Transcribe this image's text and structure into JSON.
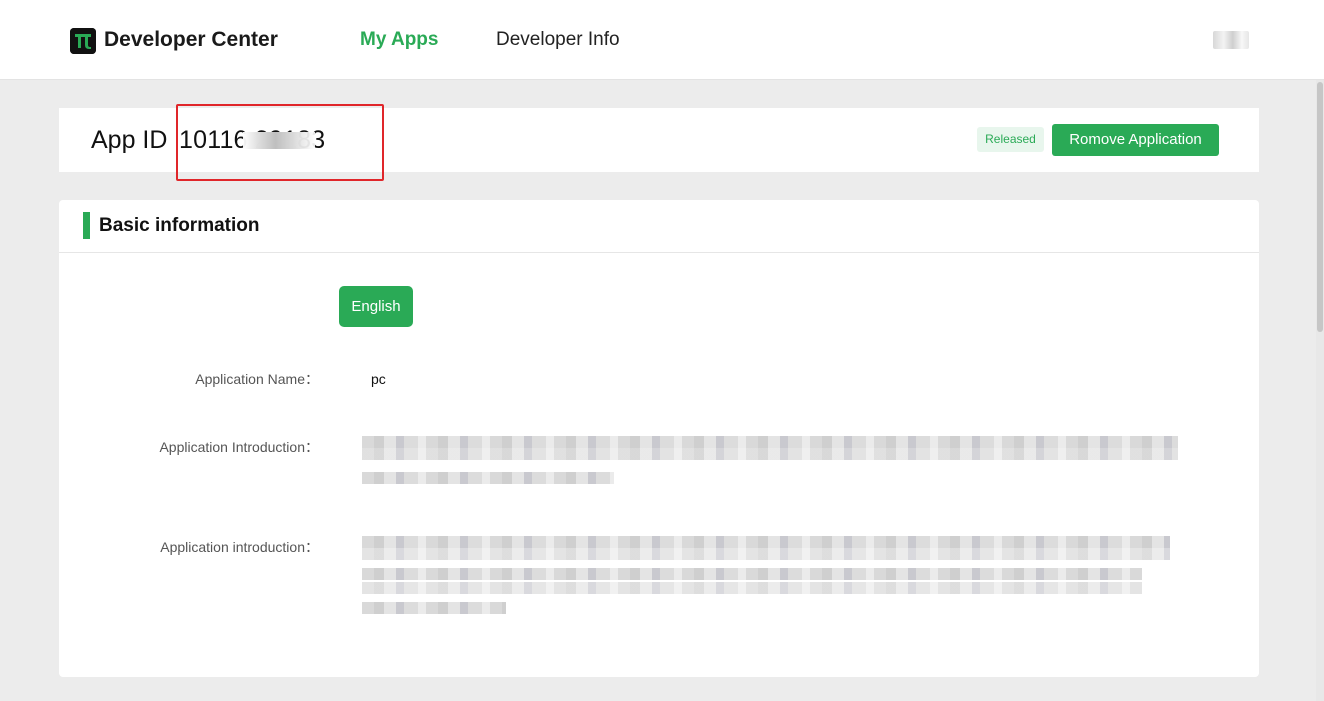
{
  "header": {
    "brand": "Developer Center",
    "nav": [
      {
        "label": "My Apps",
        "active": true
      },
      {
        "label": "Developer Info",
        "active": false
      }
    ]
  },
  "app": {
    "id_label": "App ID",
    "id_value": "10116      29183",
    "status_badge": "Released",
    "remove_button": "Romove Application"
  },
  "basic_info": {
    "section_title": "Basic information",
    "language_button": "English",
    "fields": [
      {
        "label": "Application Name：",
        "value": "pc"
      },
      {
        "label": "Application Introduction："
      },
      {
        "label": "Application introduction："
      }
    ]
  },
  "colors": {
    "accent": "#2aaa56",
    "highlight_box": "#e0262a",
    "page_bg": "#ececec"
  }
}
